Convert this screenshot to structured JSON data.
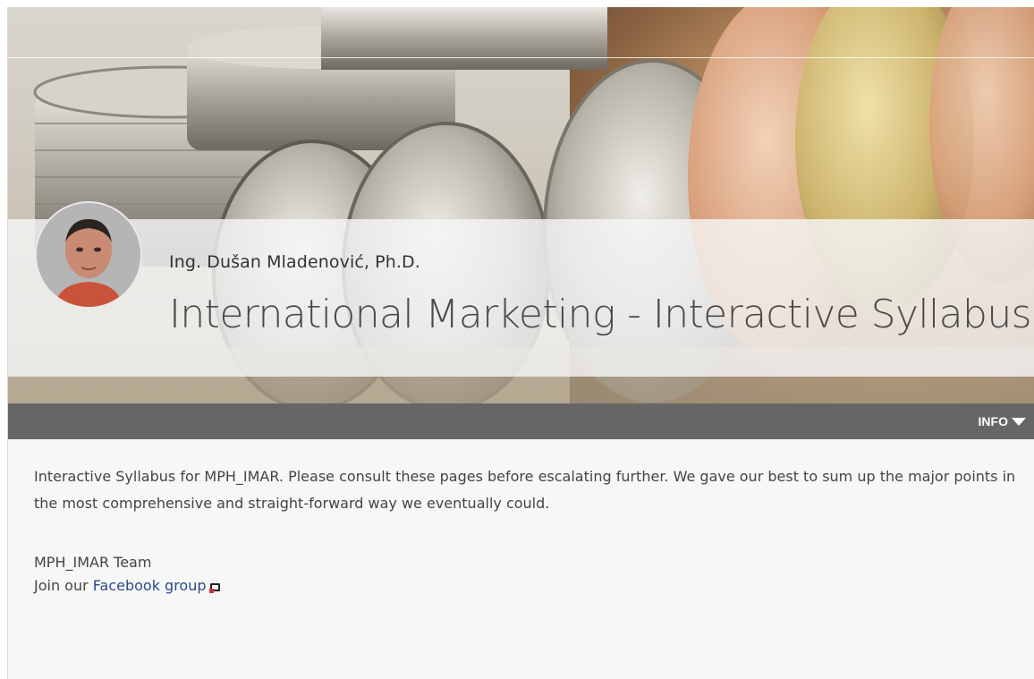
{
  "header": {
    "author": "Ing. Dušan Mladenović, Ph.D.",
    "course_title": "International Marketing - Interactive Syllabus"
  },
  "info_bar": {
    "toggle_label": "INFO",
    "toggle_icon": "caret-down-icon"
  },
  "content": {
    "description": "Interactive Syllabus for MPH_IMAR. Please consult these pages before escalating further. We gave our best to sum up the major points in the most comprehensive and straight-forward way we eventually could.",
    "team": "MPH_IMAR Team",
    "join_prefix": "Join our ",
    "join_link": "Facebook group",
    "join_icon": "external-link-icon"
  },
  "colors": {
    "info_bar_bg": "#666666",
    "link": "#2a4a8a",
    "page_bg": "#f7f7f7"
  }
}
